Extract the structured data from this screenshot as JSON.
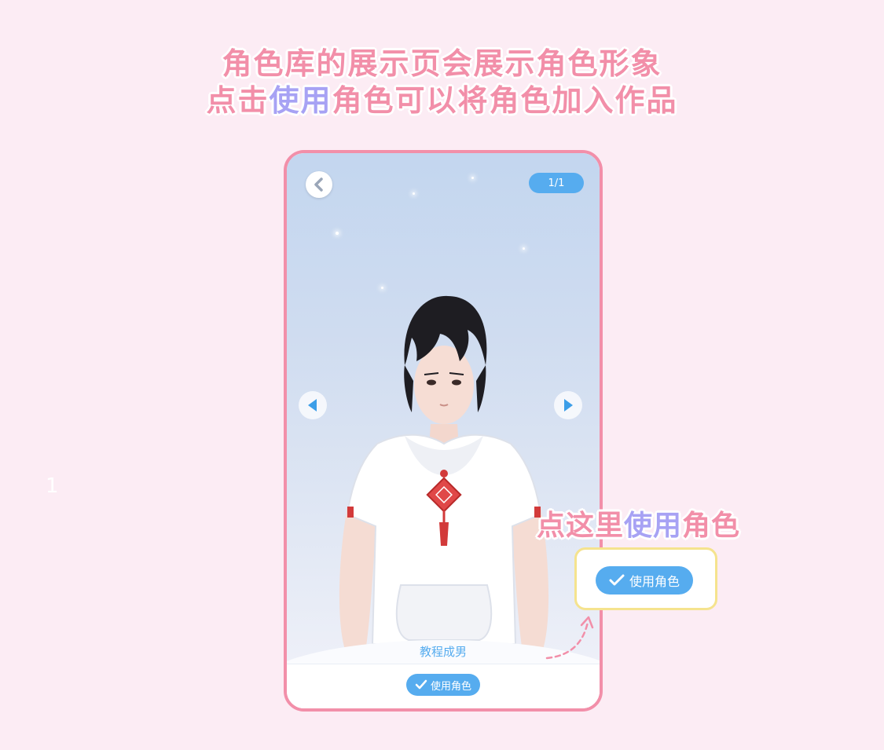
{
  "headline": {
    "line1": "角色库的展示页会展示角色形象",
    "line2_pre": "点击",
    "line2_hl1": "使用",
    "line2_hl2": "角色",
    "line2_post": "可以将角色加入作品"
  },
  "step_number": "1",
  "phone": {
    "pager": "1/1",
    "character_name": "教程成男",
    "use_button_label": "使用角色"
  },
  "callout": {
    "pre": "点这里",
    "hl1": "使用",
    "hl2": "角色",
    "button_label": "使用角色"
  },
  "colors": {
    "accent_pink": "#f28fa9",
    "accent_purple": "#a7a2f4",
    "button_blue": "#56acef",
    "highlight_yellow": "#f5e38e",
    "background": "#fcecf4"
  }
}
